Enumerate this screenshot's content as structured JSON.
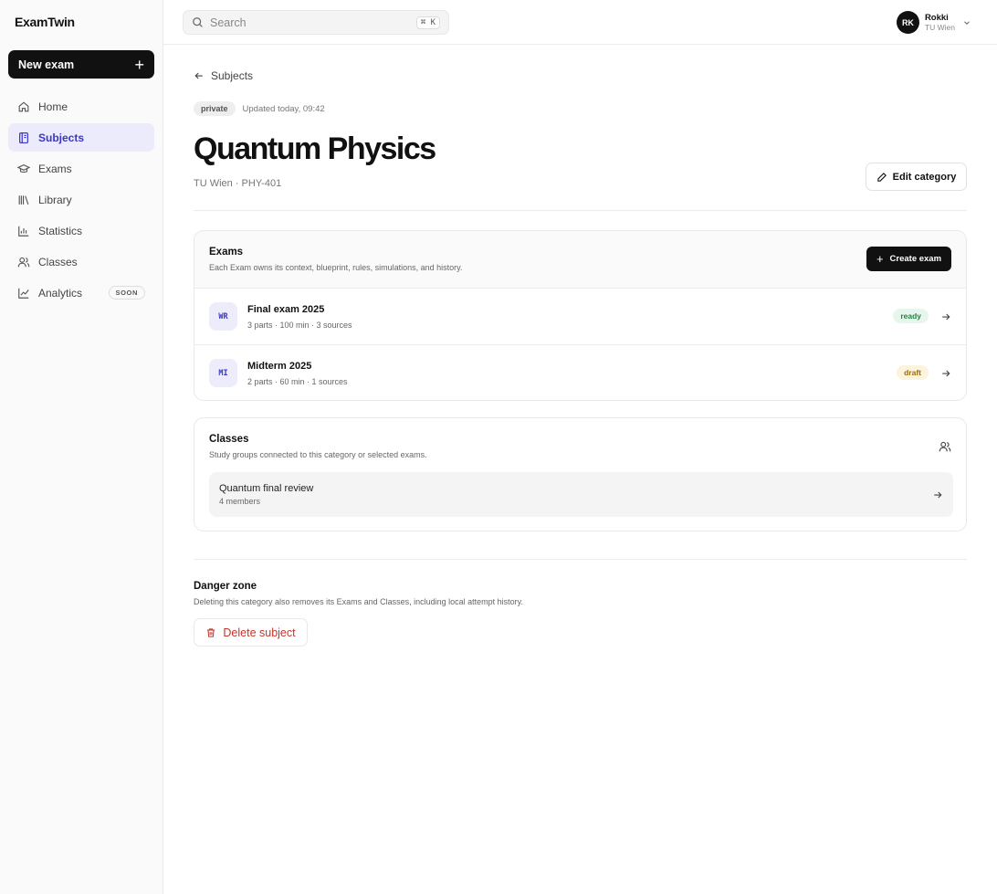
{
  "app": {
    "brand": "ExamTwin"
  },
  "sidebar": {
    "new_exam_label": "New exam",
    "items": [
      {
        "label": "Home",
        "icon": "home-icon"
      },
      {
        "label": "Subjects",
        "icon": "book-icon",
        "active": true
      },
      {
        "label": "Exams",
        "icon": "graduation-cap-icon"
      },
      {
        "label": "Library",
        "icon": "library-icon"
      },
      {
        "label": "Statistics",
        "icon": "bar-chart-icon"
      },
      {
        "label": "Classes",
        "icon": "users-icon"
      },
      {
        "label": "Analytics",
        "icon": "line-chart-icon",
        "badge": "SOON"
      }
    ]
  },
  "topbar": {
    "search_placeholder": "Search",
    "shortcut": "⌘ K",
    "user": {
      "initials": "RK",
      "name": "Rokki",
      "org": "TU Wien"
    }
  },
  "page": {
    "back_label": "Subjects",
    "visibility_badge": "private",
    "updated": "Updated today, 09:42",
    "title": "Quantum Physics",
    "subtitle": "TU Wien · PHY-401",
    "edit_label": "Edit category"
  },
  "exams": {
    "title": "Exams",
    "description": "Each Exam owns its context, blueprint, rules, simulations, and history.",
    "create_label": "Create exam",
    "items": [
      {
        "tag": "WR",
        "name": "Final exam 2025",
        "info": "3 parts · 100 min · 3 sources",
        "status": "ready"
      },
      {
        "tag": "MI",
        "name": "Midterm 2025",
        "info": "2 parts · 60 min · 1 sources",
        "status": "draft"
      }
    ]
  },
  "classes": {
    "title": "Classes",
    "description": "Study groups connected to this category or selected exams.",
    "items": [
      {
        "name": "Quantum final review",
        "members": "4 members"
      }
    ]
  },
  "danger": {
    "title": "Danger zone",
    "description": "Deleting this category also removes its Exams and Classes, including local attempt history.",
    "delete_label": "Delete subject"
  },
  "colors": {
    "accent": "#3b35c8",
    "accent_bg": "#ebebfb",
    "ready": "#22853f",
    "draft": "#9a6a12",
    "danger": "#c2352b"
  }
}
